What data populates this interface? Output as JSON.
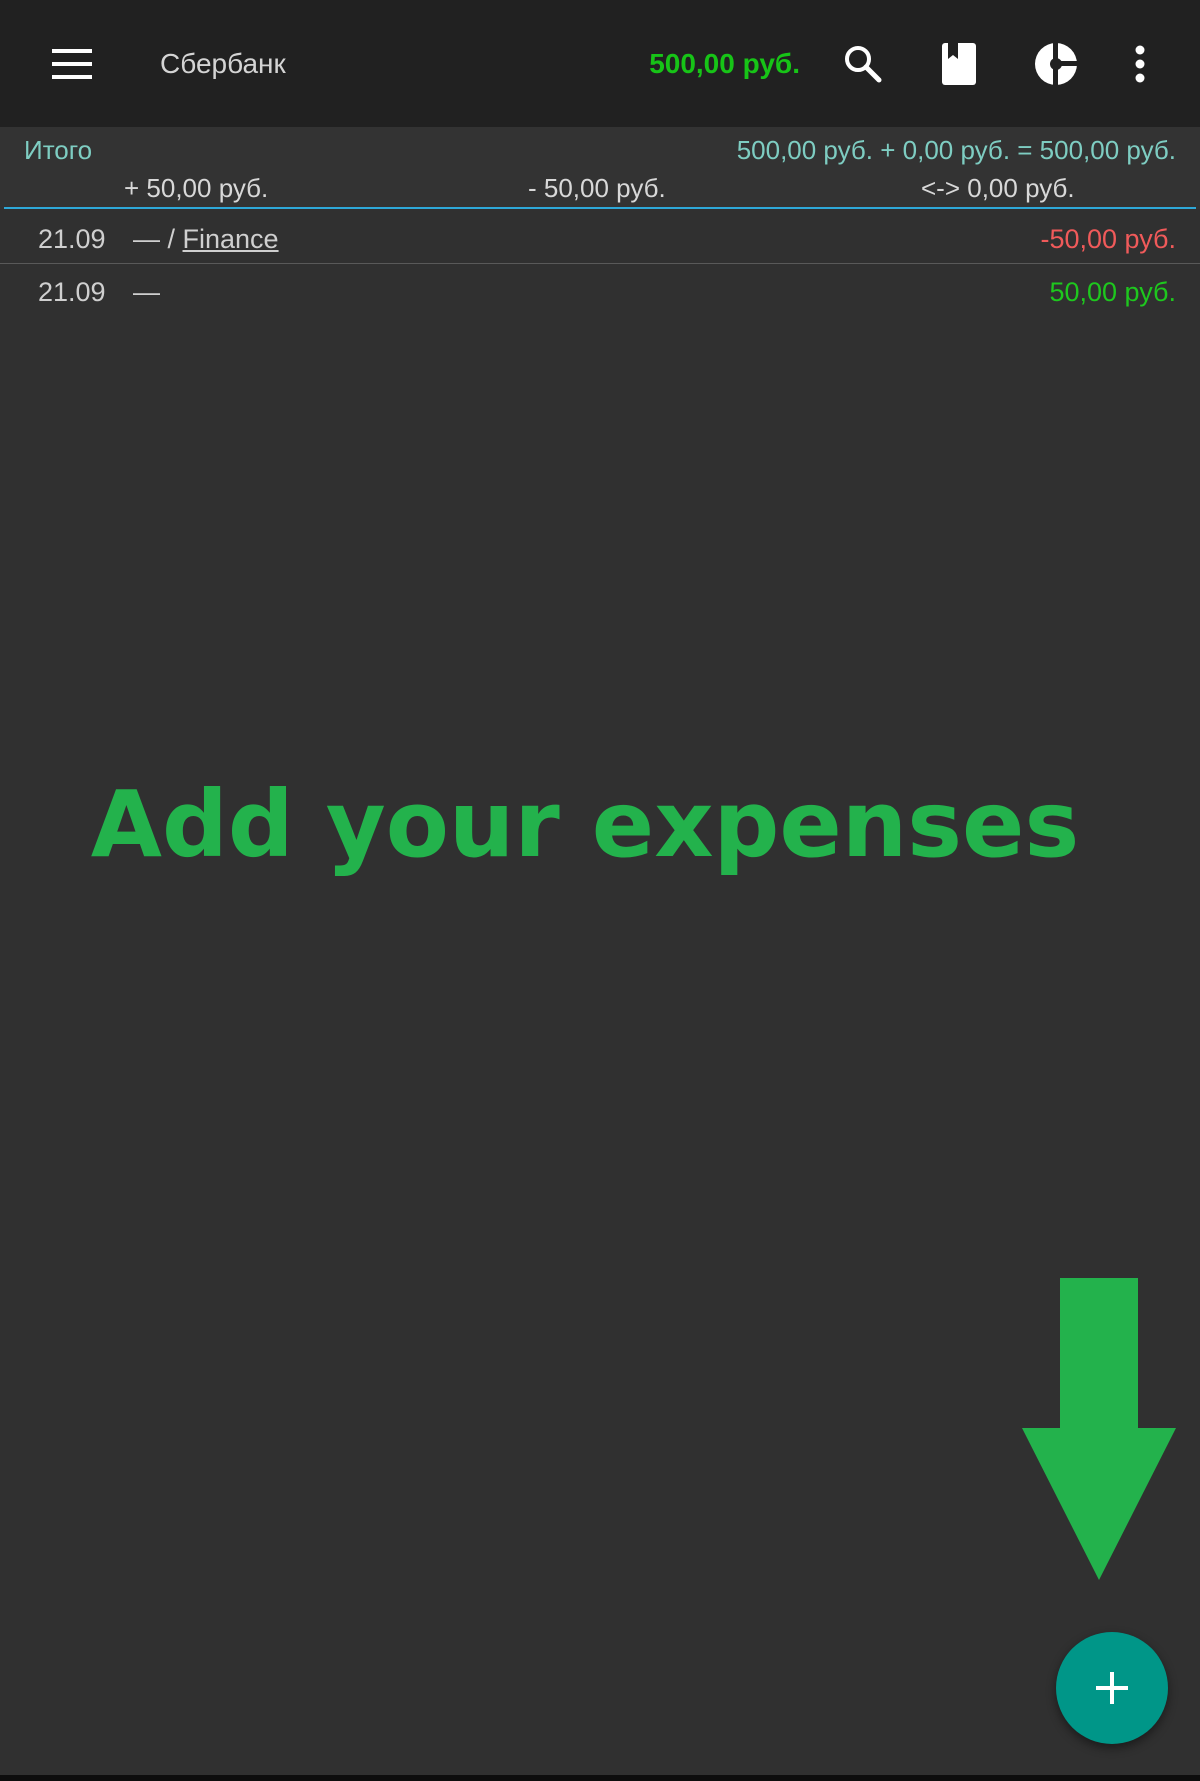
{
  "toolbar": {
    "account_title": "Сбербанк",
    "balance": "500,00 руб.",
    "balance_color": "#17c417",
    "icons": {
      "menu": "hamburger-menu-icon",
      "search": "search-icon",
      "book": "bookmark-book-icon",
      "chart": "pie-chart-icon",
      "more": "more-vert-icon"
    }
  },
  "totals": {
    "label": "Итого",
    "sum": "500,00 руб. + 0,00 руб. = 500,00 руб.",
    "income": "+ 50,00 руб.",
    "expense": "- 50,00 руб.",
    "transfer": "<-> 0,00 руб."
  },
  "transactions": [
    {
      "date": "21.09",
      "payee": "— / ",
      "category": "Finance",
      "amount": "-50,00 руб.",
      "amount_color": "#f05a5a"
    },
    {
      "date": "21.09",
      "payee": "—",
      "category": "",
      "amount": "50,00 руб.",
      "amount_color": "#1ec71e"
    }
  ],
  "hint": {
    "text": "Add your expenses",
    "color": "#23b24c"
  },
  "fab": {
    "icon": "plus-icon",
    "color": "#009688"
  }
}
